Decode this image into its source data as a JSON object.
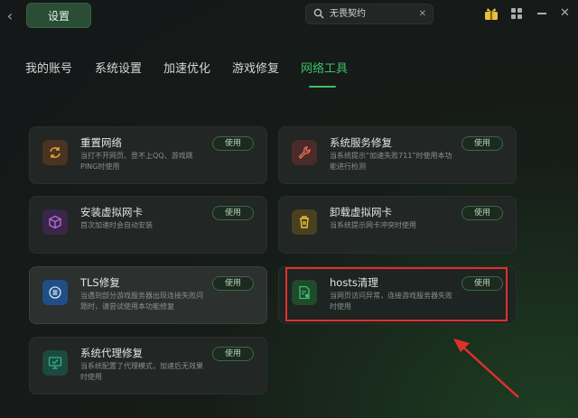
{
  "header": {
    "back_glyph": "‹",
    "title": "设置",
    "search_value": "无畏契约",
    "clear_glyph": "✕",
    "close_glyph": "✕"
  },
  "tabs": [
    {
      "label": "我的账号",
      "active": false
    },
    {
      "label": "系统设置",
      "active": false
    },
    {
      "label": "加速优化",
      "active": false
    },
    {
      "label": "游戏修复",
      "active": false
    },
    {
      "label": "网络工具",
      "active": true
    }
  ],
  "tools": [
    {
      "name": "重置网络",
      "desc": "当打不开网页、登不上QQ、游戏跳PING时使用",
      "button": "使用",
      "icon": "refresh-icon",
      "color": "#e39a3a"
    },
    {
      "name": "系统服务修复",
      "desc": "当系统提示“加速失败711”时使用本功能进行检测",
      "button": "使用",
      "icon": "wrench-icon",
      "color": "#e26e5a"
    },
    {
      "name": "安装虚拟网卡",
      "desc": "首次加速时会自动安装",
      "button": "使用",
      "icon": "cube-icon",
      "color": "#b469d9"
    },
    {
      "name": "卸载虚拟网卡",
      "desc": "当系统提示网卡冲突时使用",
      "button": "使用",
      "icon": "trash-icon",
      "color": "#e6c13a"
    },
    {
      "name": "TLS修复",
      "desc": "当遇到部分游戏服务器出现连接失败问题时，请尝试使用本功能修复",
      "button": "使用",
      "icon": "tls-icon",
      "color": "#3f8fe8"
    },
    {
      "name": "hosts清理",
      "desc": "当网页访问异常，连接游戏服务器失败时使用",
      "button": "使用",
      "icon": "doc-icon",
      "color": "#3fbf6a"
    },
    {
      "name": "系统代理修复",
      "desc": "当系统配置了代理模式，加速后无效果时使用",
      "button": "使用",
      "icon": "monitor-icon",
      "color": "#2fb58f"
    }
  ],
  "colors": {
    "accent": "#3cc266",
    "annotation": "#e0302c"
  }
}
